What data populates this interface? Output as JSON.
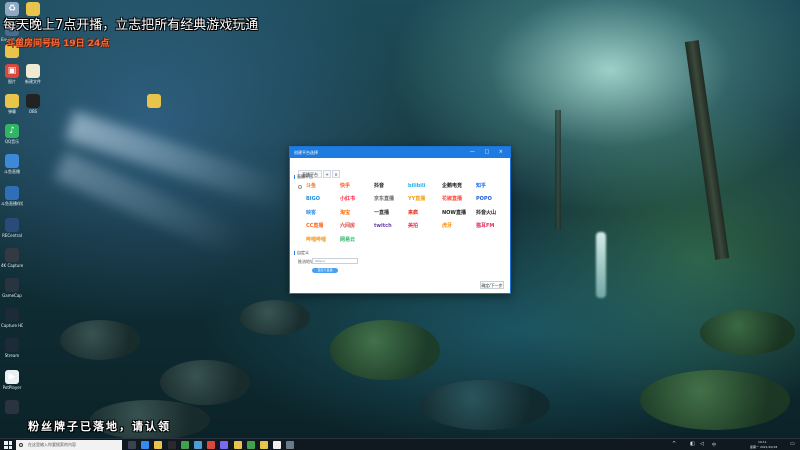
{
  "overlay": {
    "title": "每天晚上7点开播，立志把所有经典游戏玩通",
    "subtitle": "斗鱼房间号码 19日 24点",
    "bottom": "粉丝牌子已落地，请认领"
  },
  "desktop_icons": [
    {
      "label": "回收站",
      "icon": "recycle-bin-icon",
      "color": "#8fa9c4"
    },
    {
      "label": "",
      "icon": "folder-icon",
      "color": "#e8c54a"
    },
    {
      "label": "EngineerHelper",
      "icon": "app-icon",
      "color": "#4a6d8c"
    },
    {
      "label": "",
      "icon": "folder-icon",
      "color": "#e8c54a"
    },
    {
      "label": "图片",
      "icon": "image-icon",
      "color": "#d8483c"
    },
    {
      "label": "新建文件",
      "icon": "file-icon",
      "color": "#f0ead2"
    },
    {
      "label": "弹幕",
      "icon": "file-icon",
      "color": "#e8c54a"
    },
    {
      "label": "OBS",
      "icon": "app-icon",
      "color": "#222222"
    },
    {
      "label": "",
      "icon": "file-icon",
      "color": "#e8c54a"
    },
    {
      "label": "QQ音乐",
      "icon": "music-icon",
      "color": "#2fb564"
    },
    {
      "label": "斗鱼直播",
      "icon": "app-icon",
      "color": "#3d89d8"
    },
    {
      "label": "斗鱼直播伴侣",
      "icon": "app-icon",
      "color": "#2f6fb8"
    },
    {
      "label": "RECentral",
      "icon": "app-icon",
      "color": "#2a4a7a"
    },
    {
      "label": "4K Capture Utility",
      "icon": "app-icon",
      "color": "#333a44"
    },
    {
      "label": "GameCap",
      "icon": "app-icon",
      "color": "#2a3440"
    },
    {
      "label": "Capture HD",
      "icon": "app-icon",
      "color": "#1d2a38"
    },
    {
      "label": "Stream",
      "icon": "app-icon",
      "color": "#1d2a38"
    },
    {
      "label": "PotPlayer",
      "icon": "play-icon",
      "color": "#e8f0f4"
    },
    {
      "label": "",
      "icon": "app-icon",
      "color": "#2a3440"
    }
  ],
  "dialog": {
    "title": "创建平台选择",
    "window_controls": "— □ ×",
    "tabs": [
      "直播平台",
      "+",
      "×"
    ],
    "section_platforms": "直播平台",
    "section_custom": "自定义",
    "field_label": "推流地址",
    "field_placeholder": "rtmp://",
    "blue_button": "自定义直播",
    "next_button": "确定/下一步",
    "platforms": [
      {
        "label": "斗鱼",
        "color": "#f3762b"
      },
      {
        "label": "快手",
        "color": "#ff5a1f"
      },
      {
        "label": "抖音",
        "color": "#111111"
      },
      {
        "label": "bilibili",
        "color": "#23ade5"
      },
      {
        "label": "企鹅电竞",
        "color": "#1a1a1a"
      },
      {
        "label": "知乎",
        "color": "#1772f6"
      },
      {
        "label": "BIGO",
        "color": "#1d8ede"
      },
      {
        "label": "小红书",
        "color": "#ff2442"
      },
      {
        "label": "京东直播",
        "color": "#6a6a6a"
      },
      {
        "label": "YY直播",
        "color": "#f0a21c"
      },
      {
        "label": "花椒直播",
        "color": "#ff4a3a"
      },
      {
        "label": "POPO",
        "color": "#1f5fd0"
      },
      {
        "label": "映客",
        "color": "#2f8ef0"
      },
      {
        "label": "淘宝",
        "color": "#ff6a00"
      },
      {
        "label": "一直播",
        "color": "#333333"
      },
      {
        "label": "来疯",
        "color": "#e0311b"
      },
      {
        "label": "NOW直播",
        "color": "#222222"
      },
      {
        "label": "抖音火山",
        "color": "#111111"
      },
      {
        "label": "CC直播",
        "color": "#ff6a1f"
      },
      {
        "label": "六间房",
        "color": "#e03b3b"
      },
      {
        "label": "twitch",
        "color": "#6441a5"
      },
      {
        "label": "美拍",
        "color": "#f03560"
      },
      {
        "label": "虎牙",
        "color": "#ff8a00"
      },
      {
        "label": "猫耳FM",
        "color": "#e0315a"
      },
      {
        "label": "哔哩哔哩",
        "color": "#f59a23"
      },
      {
        "label": "网易云",
        "color": "#2fb564"
      }
    ]
  },
  "taskbar": {
    "search_placeholder": "在这里输入你要搜索的内容",
    "clock_time": "19:11",
    "clock_date": "星期一 2021/10/18",
    "tray_language": "中",
    "pinned": [
      {
        "icon": "task-view-icon",
        "color": "#3a4450"
      },
      {
        "icon": "edge-icon",
        "color": "#2f8ef0"
      },
      {
        "icon": "explorer-icon",
        "color": "#e8c54a"
      },
      {
        "icon": "obs-icon",
        "color": "#2a2a2a"
      },
      {
        "icon": "chrome-icon",
        "color": "#3fa34d"
      },
      {
        "icon": "store-icon",
        "color": "#4a9fd8"
      },
      {
        "icon": "app-icon",
        "color": "#d8483c"
      },
      {
        "icon": "app-icon",
        "color": "#7a6af0"
      },
      {
        "icon": "app-icon",
        "color": "#e8c54a"
      },
      {
        "icon": "app-icon",
        "color": "#3fa34d"
      },
      {
        "icon": "app-icon",
        "color": "#e8c54a"
      },
      {
        "icon": "app-icon",
        "color": "#f0f0f0"
      },
      {
        "icon": "app-icon",
        "color": "#6a7a8a"
      }
    ]
  }
}
